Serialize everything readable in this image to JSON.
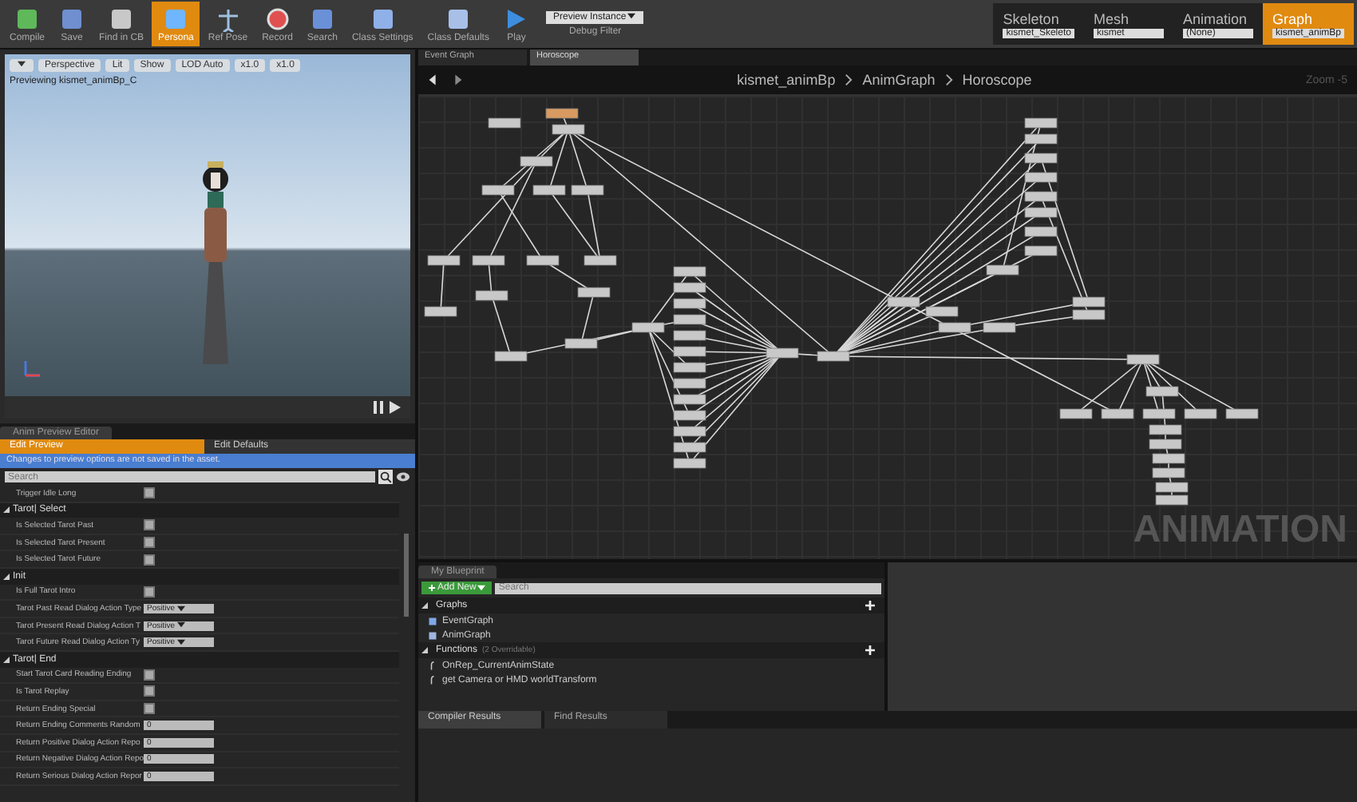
{
  "toolbar": {
    "buttons": [
      {
        "label": "Compile",
        "kind": "compile",
        "selected": false
      },
      {
        "label": "Save",
        "kind": "save",
        "selected": false
      },
      {
        "label": "Find in CB",
        "kind": "find",
        "selected": false
      },
      {
        "label": "Persona",
        "kind": "persona",
        "selected": true
      },
      {
        "label": "Ref Pose",
        "kind": "pose",
        "selected": false
      },
      {
        "label": "Record",
        "kind": "record",
        "selected": false
      },
      {
        "label": "Search",
        "kind": "search",
        "selected": false
      },
      {
        "label": "Class Settings",
        "kind": "settings",
        "selected": false
      },
      {
        "label": "Class Defaults",
        "kind": "defaults",
        "selected": false
      },
      {
        "label": "Play",
        "kind": "play",
        "selected": false
      }
    ],
    "debug": {
      "value": "Preview Instance",
      "label": "Debug Filter"
    }
  },
  "asset_nav": [
    {
      "title": "Skeleton",
      "value": "kismet_Skeleto",
      "selected": false
    },
    {
      "title": "Mesh",
      "value": "kismet",
      "selected": false
    },
    {
      "title": "Animation",
      "value": "(None)",
      "selected": false
    },
    {
      "title": "Graph",
      "value": "kismet_animBp",
      "selected": true
    }
  ],
  "viewport": {
    "buttons": [
      "Perspective",
      "Lit",
      "Show",
      "LOD Auto",
      "x1.0",
      "x1.0"
    ],
    "caption": "Previewing kismet_animBp_C"
  },
  "anim_preview": {
    "tab": "Anim Preview Editor",
    "subtabs": [
      {
        "label": "Edit Preview",
        "selected": true
      },
      {
        "label": "Edit Defaults",
        "selected": false
      }
    ],
    "notice": "Changes to preview options are not saved in the asset.",
    "search": {
      "placeholder": "Search"
    },
    "top_rows": [
      {
        "label": "Trigger Idle Long",
        "kind": "checkbox",
        "checked": false
      }
    ],
    "sections": [
      {
        "title": "Tarot| Select",
        "rows": [
          {
            "label": "Is Selected Tarot Past",
            "kind": "checkbox",
            "checked": false
          },
          {
            "label": "Is Selected Tarot Present",
            "kind": "checkbox",
            "checked": false
          },
          {
            "label": "Is Selected Tarot Future",
            "kind": "checkbox",
            "checked": false
          }
        ]
      },
      {
        "title": "Init",
        "rows": [
          {
            "label": "Is Full Tarot Intro",
            "kind": "checkbox",
            "checked": false
          },
          {
            "label": "Tarot Past Read Dialog Action Type",
            "kind": "dropdown",
            "value": "Positive"
          },
          {
            "label": "Tarot Present Read Dialog Action T",
            "kind": "dropdown",
            "value": "Positive"
          },
          {
            "label": "Tarot Future Read Dialog Action Ty",
            "kind": "dropdown",
            "value": "Positive"
          }
        ]
      },
      {
        "title": "Tarot| End",
        "rows": [
          {
            "label": "Start Tarot Card Reading Ending",
            "kind": "checkbox",
            "checked": false
          },
          {
            "label": "Is Tarot Replay",
            "kind": "checkbox",
            "checked": false
          },
          {
            "label": "Return Ending Special",
            "kind": "checkbox",
            "checked": false
          },
          {
            "label": "Return Ending Comments Random",
            "kind": "number",
            "value": "0"
          },
          {
            "label": "Return Positive Dialog Action Repo",
            "kind": "number",
            "value": "0"
          },
          {
            "label": "Return Negative Dialog Action Repo",
            "kind": "number",
            "value": "0"
          },
          {
            "label": "Return Serious Dialog Action Repor",
            "kind": "number",
            "value": "0"
          }
        ]
      }
    ]
  },
  "graph": {
    "tabs": [
      {
        "label": "Event Graph",
        "selected": false
      },
      {
        "label": "Horoscope",
        "selected": true
      }
    ],
    "breadcrumb": [
      "kismet_animBp",
      "AnimGraph",
      "Horoscope"
    ],
    "zoom": "Zoom -5",
    "watermark": "ANIMATION"
  },
  "my_blueprint": {
    "tab": "My Blueprint",
    "add_button": "Add New",
    "search": {
      "placeholder": "Search"
    },
    "categories": [
      {
        "title": "Graphs",
        "items": [
          {
            "label": "EventGraph",
            "kind": "graph"
          },
          {
            "label": "AnimGraph",
            "kind": "anim"
          }
        ]
      },
      {
        "title": "Functions",
        "note": "(2 Overridable)",
        "items": [
          {
            "label": "OnRep_CurrentAnimState",
            "kind": "function"
          },
          {
            "label": "get Camera or HMD worldTransform",
            "kind": "function"
          }
        ]
      }
    ]
  },
  "results_tabs": [
    {
      "label": "Compiler Results",
      "selected": true
    },
    {
      "label": "Find Results",
      "selected": false
    }
  ]
}
